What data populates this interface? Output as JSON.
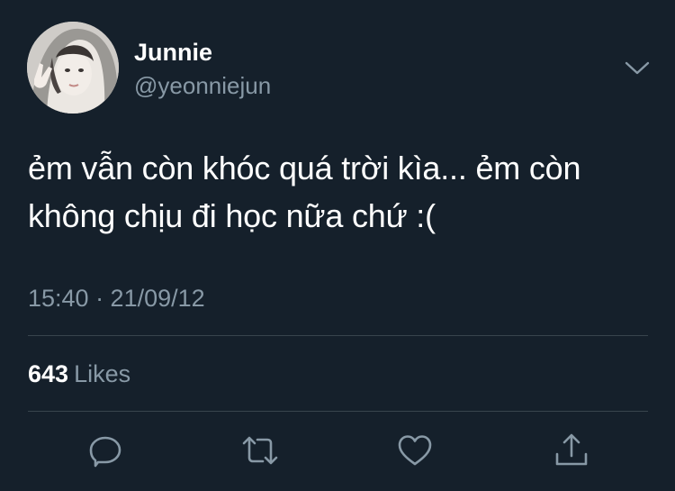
{
  "author": {
    "display_name": "Junnie",
    "handle": "@yeonniejun",
    "avatar_icon": "user-photo"
  },
  "tweet": {
    "text": "ẻm vẫn còn khóc quá trời kìa... ẻm còn không chịu đi học nữa chứ :(",
    "timestamp": "15:40 · 21/09/12"
  },
  "stats": {
    "likes_count": "643",
    "likes_label": "Likes"
  },
  "actions": [
    {
      "name": "reply",
      "icon": "speech-bubble-icon"
    },
    {
      "name": "retweet",
      "icon": "retweet-arrows-icon"
    },
    {
      "name": "like",
      "icon": "heart-icon"
    },
    {
      "name": "share",
      "icon": "share-upload-icon"
    }
  ],
  "colors": {
    "background": "#15202b",
    "primary_text": "#ffffff",
    "secondary_text": "#8899a6",
    "divider": "#38444d",
    "icon": "#8899a6"
  }
}
